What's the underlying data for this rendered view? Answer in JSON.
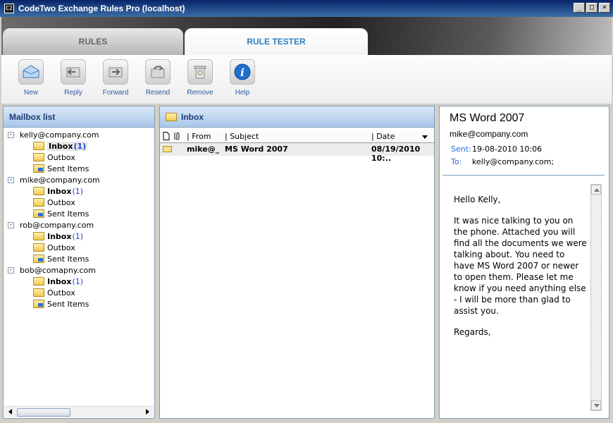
{
  "window": {
    "title": "CodeTwo Exchange Rules Pro (localhost)",
    "app_icon_text": "C2",
    "min": "_",
    "max": "□",
    "close": "×"
  },
  "tabs": [
    {
      "label": "RULES"
    },
    {
      "label": "RULE TESTER"
    }
  ],
  "toolbar": [
    {
      "label": "New",
      "icon": "new-icon"
    },
    {
      "label": "Reply",
      "icon": "reply-icon"
    },
    {
      "label": "Forward",
      "icon": "forward-icon"
    },
    {
      "label": "Resend",
      "icon": "resend-icon"
    },
    {
      "label": "Remove",
      "icon": "remove-icon"
    },
    {
      "label": "Help",
      "icon": "help-icon"
    }
  ],
  "mailbox": {
    "title": "Mailbox list",
    "accounts": [
      {
        "name": "kelly@company.com",
        "inbox": "Inbox",
        "count": "(1)",
        "outbox": "Outbox",
        "sent": "Sent Items"
      },
      {
        "name": "mike@company.com",
        "inbox": "Inbox",
        "count": "(1)",
        "outbox": "Outbox",
        "sent": "Sent Items"
      },
      {
        "name": "rob@company.com",
        "inbox": "Inbox",
        "count": "(1)",
        "outbox": "Outbox",
        "sent": "Sent Items"
      },
      {
        "name": "bob@comapny.com",
        "inbox": "Inbox",
        "count": "(1)",
        "outbox": "Outbox",
        "sent": "Sent Items"
      }
    ]
  },
  "inbox": {
    "title": "Inbox",
    "columns": {
      "from": "| From",
      "subject": "| Subject",
      "date": "| Date"
    },
    "row": {
      "from": "mike@_",
      "subject": "MS Word 2007",
      "date": "08/19/2010 10:.."
    }
  },
  "preview": {
    "subject": "MS Word 2007",
    "sender": "mike@company.com",
    "sent_label": "Sent:",
    "sent_value": "19-08-2010 10:06",
    "to_label": "To:",
    "to_value": "kelly@company.com;",
    "body": [
      "Hello Kelly,",
      "It was nice talking to you on the phone. Attached you will find all the documents we were talking about. You need to have MS Word 2007 or newer to open them. Please let me know if you need anything else - I will be more than glad to assist you.",
      "Regards,"
    ]
  },
  "colors": {
    "accent": "#2b7fc0",
    "panel_header": "#a9c7ea",
    "link_blue": "#1b48c9"
  }
}
